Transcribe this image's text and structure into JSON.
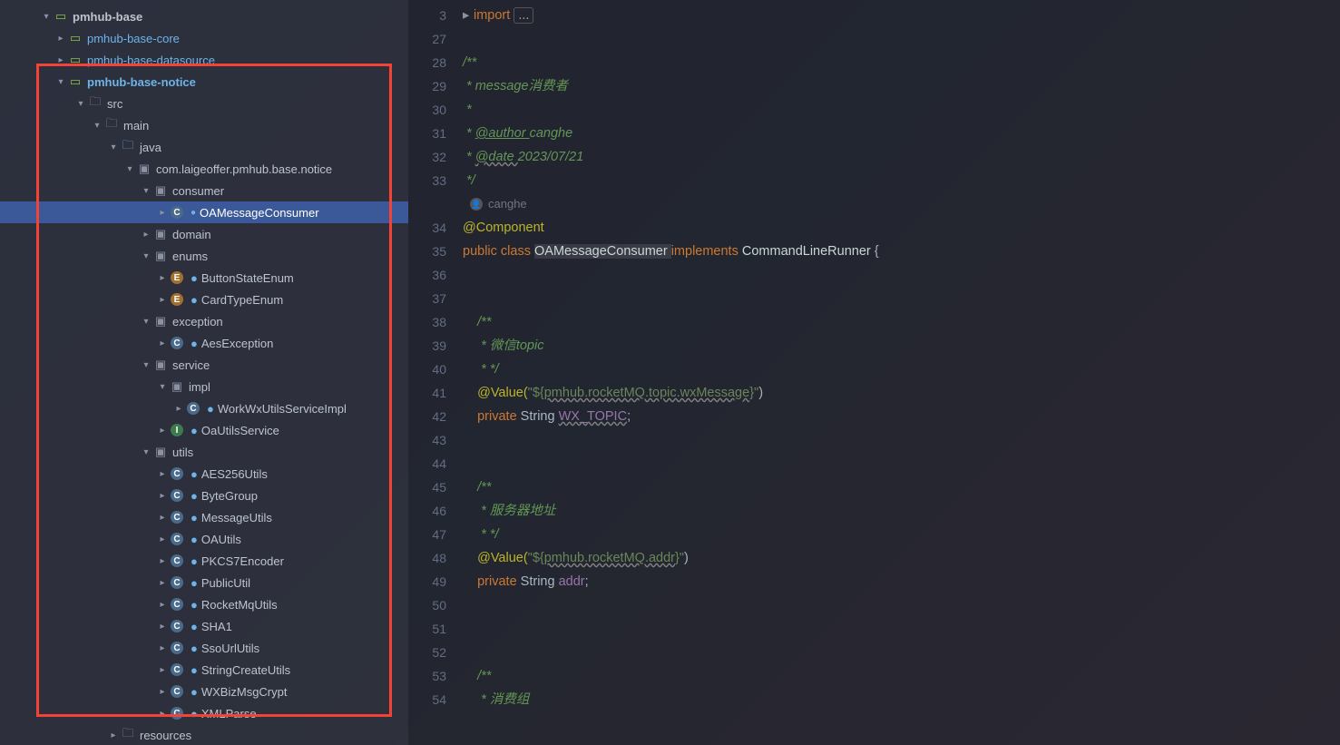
{
  "tree": {
    "n0": "pmhub-base",
    "n1": "pmhub-base-core",
    "n2": "pmhub-base-datasource",
    "n3": "pmhub-base-notice",
    "n4": "src",
    "n5": "main",
    "n6": "java",
    "n7": "com.laigeoffer.pmhub.base.notice",
    "n8": "consumer",
    "n9": "OAMessageConsumer",
    "n10": "domain",
    "n11": "enums",
    "n12": "ButtonStateEnum",
    "n13": "CardTypeEnum",
    "n14": "exception",
    "n15": "AesException",
    "n16": "service",
    "n17": "impl",
    "n18": "WorkWxUtilsServiceImpl",
    "n19": "OaUtilsService",
    "n20": "utils",
    "n21": "AES256Utils",
    "n22": "ByteGroup",
    "n23": "MessageUtils",
    "n24": "OAUtils",
    "n25": "PKCS7Encoder",
    "n26": "PublicUtil",
    "n27": "RocketMqUtils",
    "n28": "SHA1",
    "n29": "SsoUrlUtils",
    "n30": "StringCreateUtils",
    "n31": "WXBizMsgCrypt",
    "n32": "XMLParse",
    "n33": "resources"
  },
  "lineNums": [
    "3",
    "27",
    "28",
    "29",
    "30",
    "31",
    "32",
    "33",
    "",
    "34",
    "35",
    "36",
    "37",
    "38",
    "39",
    "40",
    "41",
    "42",
    "43",
    "44",
    "45",
    "46",
    "47",
    "48",
    "49",
    "50",
    "51",
    "52",
    "53",
    "54"
  ],
  "code": {
    "l3_import": "import ",
    "l3_dots": "...",
    "l28": "/**",
    "l29a": " * ",
    "l29b": "message",
    "l29c": "消费者",
    "l30": " *",
    "l31a": " * ",
    "l31b": "@author ",
    "l31c": "canghe",
    "l32a": " * ",
    "l32b": "@date ",
    "l32c": "2023/07/21",
    "l33": " */",
    "author": "canghe",
    "l34a": "@Component",
    "l35_public": "public ",
    "l35_class": "class ",
    "l35_name": "OAMessageConsumer ",
    "l35_impl": "implements ",
    "l35_intf": "CommandLineRunner ",
    "l35_brace": "{",
    "l38": "    /**",
    "l39": "     * 微信",
    "l39b": "topic",
    "l40": "     * */",
    "l41a": "    @Value(",
    "l41b": "\"${",
    "l41c": "pmhub.rocketMQ.topic.wxMessage",
    "l41d": "}\"",
    "l41e": ")",
    "l42a": "    private ",
    "l42b": "String ",
    "l42c": "WX_TOPIC",
    "l42d": ";",
    "l45": "    /**",
    "l46": "     * 服务器地址",
    "l47": "     * */",
    "l48a": "    @Value(",
    "l48b": "\"${",
    "l48c": "pmhub.rocketMQ.addr",
    "l48d": "}\"",
    "l48e": ")",
    "l49a": "    private ",
    "l49b": "String ",
    "l49c": "addr",
    "l49d": ";",
    "l53": "    /**",
    "l54": "     * 消费组"
  }
}
